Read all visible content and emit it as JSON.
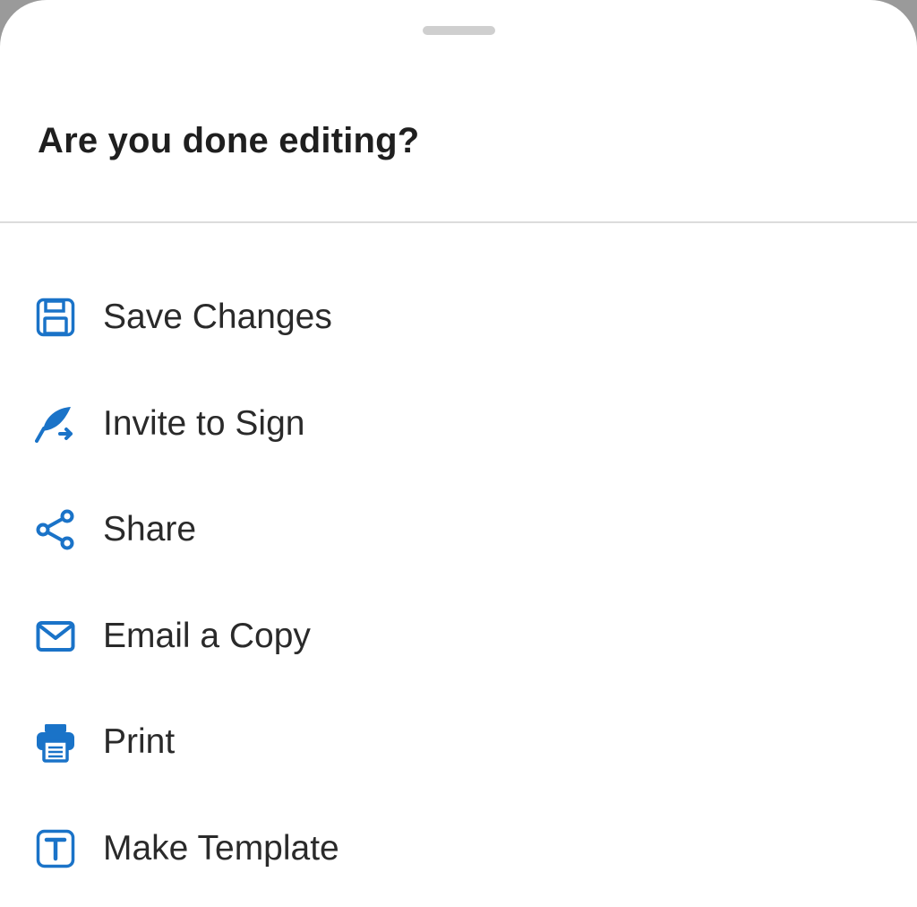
{
  "sheet": {
    "title": "Are you done editing?",
    "accent_color": "#1a73c8"
  },
  "menu": {
    "items": [
      {
        "label": "Save Changes",
        "icon": "save-icon"
      },
      {
        "label": "Invite to Sign",
        "icon": "feather-sign-icon"
      },
      {
        "label": "Share",
        "icon": "share-icon"
      },
      {
        "label": "Email a Copy",
        "icon": "email-icon"
      },
      {
        "label": "Print",
        "icon": "print-icon"
      },
      {
        "label": "Make Template",
        "icon": "template-icon"
      }
    ]
  }
}
